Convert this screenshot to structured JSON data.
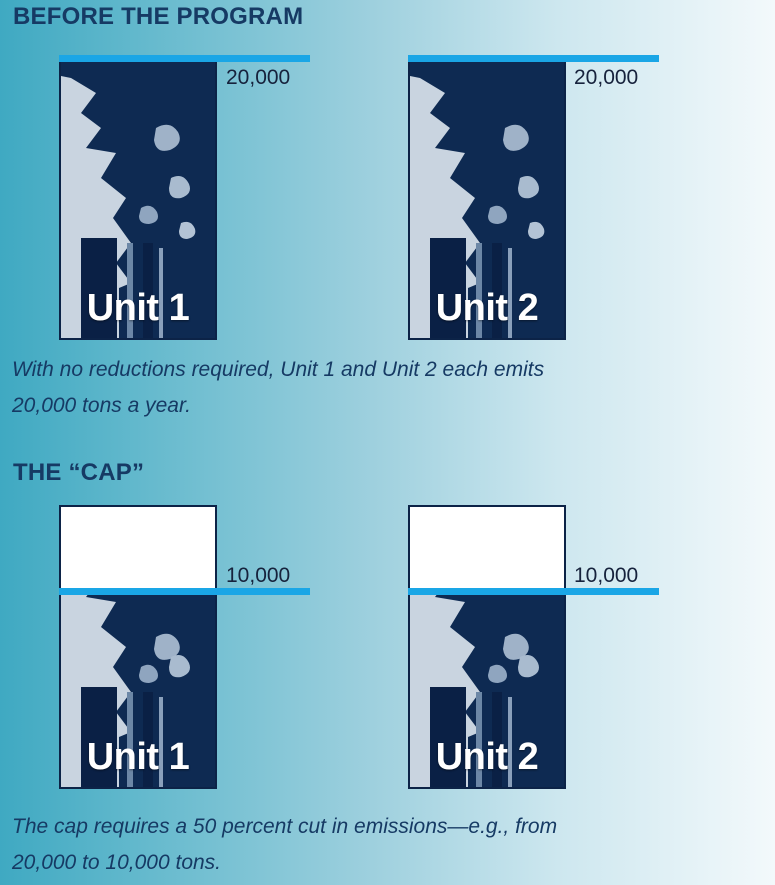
{
  "before": {
    "heading": "BEFORE THE PROGRAM",
    "units": [
      {
        "label": "Unit 1",
        "amount_label": "20,000",
        "emissions_tons": 20000
      },
      {
        "label": "Unit 2",
        "amount_label": "20,000",
        "emissions_tons": 20000
      }
    ],
    "caption_line1": "With no reductions required, Unit 1 and Unit 2 each emits",
    "caption_line2": "20,000 tons a year."
  },
  "cap": {
    "heading": "THE “CAP”",
    "units": [
      {
        "label": "Unit 1",
        "amount_label": "10,000",
        "cap_tons": 10000
      },
      {
        "label": "Unit 2",
        "amount_label": "10,000",
        "cap_tons": 10000
      }
    ],
    "caption_line1": "The cap requires a 50 percent cut in emissions—e.g., from",
    "caption_line2": "20,000 to 10,000 tons."
  },
  "colors": {
    "cap_line": "#1aa6e6",
    "heading_text": "#163a64",
    "smoke_dark": "#0e2a52",
    "sky": "#c9d4e0"
  }
}
